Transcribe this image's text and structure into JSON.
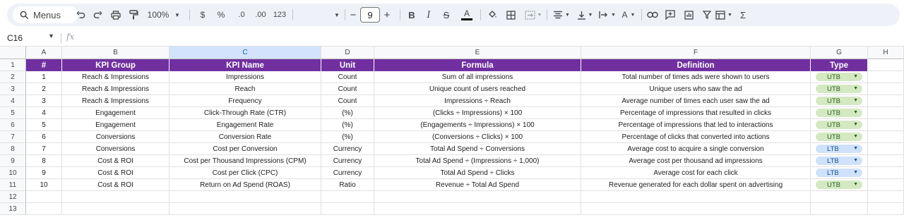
{
  "toolbar": {
    "menus_label": "Menus",
    "zoom": "100%",
    "currency": "$",
    "percent": "%",
    "decrease_decimal": ".0",
    "increase_decimal": ".00",
    "number_format": "123",
    "font_size": "9"
  },
  "formula_bar": {
    "name_box": "C16",
    "fx_label": "fx",
    "value": ""
  },
  "columns": [
    "A",
    "B",
    "C",
    "D",
    "E",
    "F",
    "G",
    "H"
  ],
  "selected_column": "C",
  "rows": [
    "1",
    "2",
    "3",
    "4",
    "5",
    "6",
    "7",
    "8",
    "9",
    "10",
    "11",
    "12",
    "13"
  ],
  "table": {
    "headers": [
      "#",
      "KPI Group",
      "KPI Name",
      "Unit",
      "Formula",
      "Definition",
      "Type"
    ],
    "header_color": "#7030a0",
    "rows": [
      {
        "num": "1",
        "group": "Reach & Impressions",
        "name": "Impressions",
        "unit": "Count",
        "formula": "Sum of all impressions",
        "definition": "Total number of times ads were shown to users",
        "type": "UTB"
      },
      {
        "num": "2",
        "group": "Reach & Impressions",
        "name": "Reach",
        "unit": "Count",
        "formula": "Unique count of users reached",
        "definition": "Unique users who saw the ad",
        "type": "UTB"
      },
      {
        "num": "3",
        "group": "Reach & Impressions",
        "name": "Frequency",
        "unit": "Count",
        "formula": "Impressions ÷ Reach",
        "definition": "Average number of times each user saw the ad",
        "type": "UTB"
      },
      {
        "num": "4",
        "group": "Engagement",
        "name": "Click-Through Rate (CTR)",
        "unit": "(%)",
        "formula": "(Clicks ÷ Impressions) × 100",
        "definition": "Percentage of impressions that resulted in clicks",
        "type": "UTB"
      },
      {
        "num": "5",
        "group": "Engagement",
        "name": "Engagement Rate",
        "unit": "(%)",
        "formula": "(Engagements ÷ Impressions) × 100",
        "definition": "Percentage of impressions that led to interactions",
        "type": "UTB"
      },
      {
        "num": "6",
        "group": "Conversions",
        "name": "Conversion Rate",
        "unit": "(%)",
        "formula": "(Conversions ÷ Clicks) × 100",
        "definition": "Percentage of clicks that converted into actions",
        "type": "UTB"
      },
      {
        "num": "7",
        "group": "Conversions",
        "name": "Cost per Conversion",
        "unit": "Currency",
        "formula": "Total Ad Spend ÷ Conversions",
        "definition": "Average cost to acquire a single conversion",
        "type": "LTB"
      },
      {
        "num": "8",
        "group": "Cost & ROI",
        "name": "Cost per Thousand Impressions (CPM)",
        "unit": "Currency",
        "formula": "Total Ad Spend ÷ (Impressions ÷ 1,000)",
        "definition": "Average cost per thousand ad impressions",
        "type": "LTB"
      },
      {
        "num": "9",
        "group": "Cost & ROI",
        "name": "Cost per Click (CPC)",
        "unit": "Currency",
        "formula": "Total Ad Spend ÷ Clicks",
        "definition": "Average cost for each click",
        "type": "LTB"
      },
      {
        "num": "10",
        "group": "Cost & ROI",
        "name": "Return on Ad Spend (ROAS)",
        "unit": "Ratio",
        "formula": "Revenue ÷ Total Ad Spend",
        "definition": "Revenue generated for each dollar spent on advertising",
        "type": "UTB"
      }
    ]
  },
  "type_chip_colors": {
    "UTB": "#d4e9c2",
    "LTB": "#cfe2fb"
  }
}
